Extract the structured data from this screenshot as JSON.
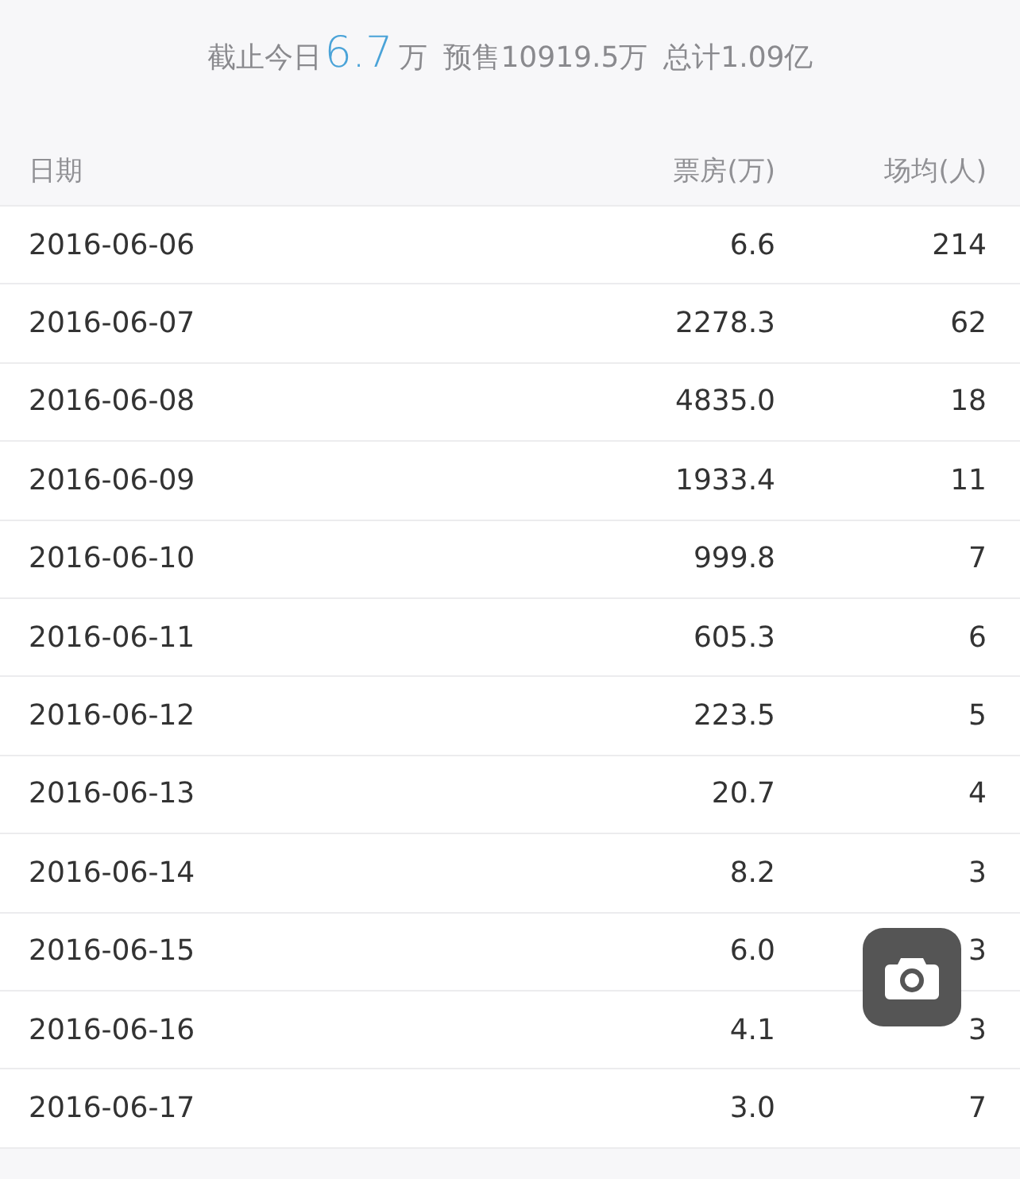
{
  "summary": {
    "prefix": "截止今日",
    "today": "6.7",
    "today_unit": "万",
    "presale": "预售10919.5万",
    "total": "总计1.09亿"
  },
  "table": {
    "columns": [
      "日期",
      "票房(万)",
      "场均(人)"
    ],
    "rows": [
      [
        "2016-06-06",
        "6.6",
        "214"
      ],
      [
        "2016-06-07",
        "2278.3",
        "62"
      ],
      [
        "2016-06-08",
        "4835.0",
        "18"
      ],
      [
        "2016-06-09",
        "1933.4",
        "11"
      ],
      [
        "2016-06-10",
        "999.8",
        "7"
      ],
      [
        "2016-06-11",
        "605.3",
        "6"
      ],
      [
        "2016-06-12",
        "223.5",
        "5"
      ],
      [
        "2016-06-13",
        "20.7",
        "4"
      ],
      [
        "2016-06-14",
        "8.2",
        "3"
      ],
      [
        "2016-06-15",
        "6.0",
        "3"
      ],
      [
        "2016-06-16",
        "4.1",
        "3"
      ],
      [
        "2016-06-17",
        "3.0",
        "7"
      ]
    ]
  },
  "floating_button": {
    "kind": "camera"
  }
}
